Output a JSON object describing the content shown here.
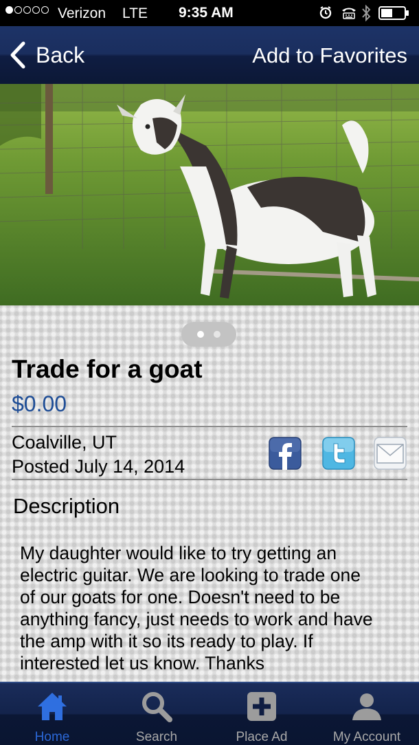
{
  "status_bar": {
    "carrier": "Verizon",
    "network": "LTE",
    "time": "9:35 AM",
    "signal_bars_filled": 1,
    "signal_bars_total": 5
  },
  "nav": {
    "back_label": "Back",
    "favorites_label": "Add to Favorites"
  },
  "photo": {
    "pages_total": 2,
    "current_page": 1
  },
  "listing": {
    "title": "Trade for a goat",
    "price": "$0.00",
    "location": "Coalville, UT",
    "posted": "Posted July 14, 2014",
    "description_heading": "Description",
    "description_lines": [
      "My daughter would like to try getting an",
      "electric guitar.  We are looking to trade one",
      "of our goats for one.  Doesn't need to be",
      "anything fancy, just needs to work and have",
      "the amp with it so its ready to play.  If",
      "interested let us know.  Thanks"
    ]
  },
  "share_icons": [
    "facebook-icon",
    "twitter-icon",
    "email-icon"
  ],
  "tabs": [
    {
      "label": "Home",
      "icon": "home-icon",
      "active": true
    },
    {
      "label": "Search",
      "icon": "search-icon",
      "active": false
    },
    {
      "label": "Place Ad",
      "icon": "plus-icon",
      "active": false
    },
    {
      "label": "My Account",
      "icon": "user-icon",
      "active": false
    }
  ],
  "colors": {
    "nav_background": "#1a2e5e",
    "price_text": "#1e4d96",
    "active_tab": "#2b68d8",
    "inactive_tab": "#a9a9a9"
  }
}
